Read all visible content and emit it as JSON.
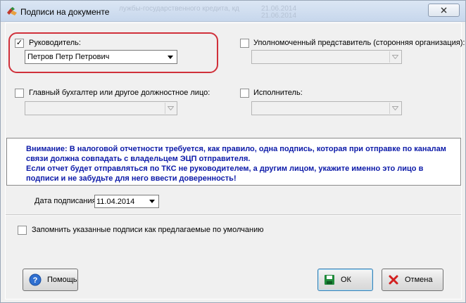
{
  "window": {
    "title": "Подписи на документе",
    "ghost_text": [
      "лужбы-государственного кредита, кд",
      "21.06.2014",
      "21.06.2014"
    ]
  },
  "signers": {
    "head": {
      "label": "Руководитель:",
      "checked": true,
      "value": "Петров Петр Петрович"
    },
    "representative": {
      "label": "Уполномоченный представитель (сторонняя организация):",
      "checked": false,
      "value": ""
    },
    "accountant": {
      "label": "Главный бухгалтер или другое должностное лицо:",
      "checked": false,
      "value": ""
    },
    "executor": {
      "label": "Исполнитель:",
      "checked": false,
      "value": ""
    }
  },
  "warning": [
    "Внимание: В налоговой отчетности требуется, как правило, одна подпись, которая при отправке по каналам",
    "связи должна совпадать с владельцем ЭЦП отправителя.",
    "Если отчет будет отправляться по ТКС не руководителем, а другим лицом, укажите именно это лицо в",
    "подписи и не забудьте для него ввести доверенность!"
  ],
  "signing_date": {
    "label": "Дата подписания:",
    "value": "11.04.2014"
  },
  "remember": {
    "label": "Запомнить указанные подписи как предлагаемые по умолчанию",
    "checked": false
  },
  "buttons": {
    "help": "Помощь",
    "ok": "ОК",
    "cancel": "Отмена"
  },
  "colors": {
    "warning_text": "#0c1aa8",
    "highlight": "#d0303a",
    "ok_icon": "#1f8a3a",
    "cancel_icon": "#d21f1f",
    "help_icon": "#2f6fd0"
  },
  "icons": {
    "title": "signature-pen-icon",
    "close": "close-icon",
    "dropdown": "chevron-down-icon",
    "help": "help-icon",
    "ok": "save-disk-icon",
    "cancel": "x-icon"
  }
}
